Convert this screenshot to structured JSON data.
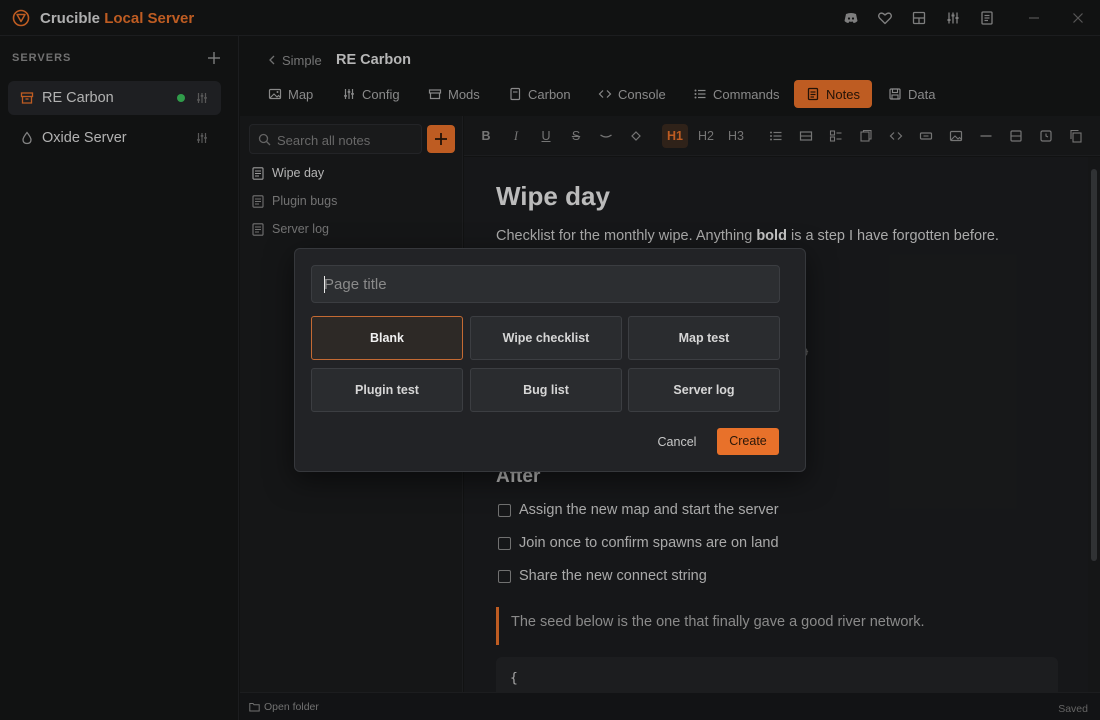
{
  "app": {
    "title_primary": "Crucible",
    "title_accent": "Local Server",
    "accent_color": "#e8712a",
    "window_icons": [
      "discord-icon",
      "heart-icon",
      "layout-icon",
      "sliders-icon",
      "document-icon",
      "minimize-icon",
      "close-icon"
    ]
  },
  "servers": {
    "heading": "SERVERS",
    "items": [
      {
        "label": "RE Carbon",
        "icon": "server-box-icon",
        "status": "running",
        "status_color": "#3bbf5b"
      },
      {
        "label": "Oxide Server",
        "icon": "droplet-icon"
      }
    ]
  },
  "header": {
    "breadcrumb_parent": "Simple",
    "breadcrumb_current": "RE Carbon",
    "tabs": [
      {
        "label": "Map",
        "icon": "image-icon"
      },
      {
        "label": "Config",
        "icon": "sliders-icon"
      },
      {
        "label": "Mods",
        "icon": "box-icon"
      },
      {
        "label": "Carbon",
        "icon": "file-icon"
      },
      {
        "label": "Console",
        "icon": "code-icon"
      },
      {
        "label": "Commands",
        "icon": "list-icon"
      },
      {
        "label": "Notes",
        "icon": "note-icon",
        "active": true
      },
      {
        "label": "Data",
        "icon": "database-icon"
      }
    ]
  },
  "notes": {
    "search_placeholder": "Search all notes",
    "items": [
      {
        "label": "Wipe day",
        "active": true
      },
      {
        "label": "Plugin bugs"
      },
      {
        "label": "Server log"
      }
    ]
  },
  "toolbar": {
    "bold": "B",
    "italic": "I",
    "underline": "U",
    "strike": "S",
    "h1": "H1",
    "h2": "H2",
    "h3": "H3"
  },
  "editor": {
    "title": "Wipe day",
    "intro_before": "Checklist for the monthly wipe. Anything ",
    "intro_bold": "bold",
    "intro_after": " is a step I have forgotten before.",
    "hidden_fragment": "ap",
    "section_after": "After",
    "checklist": [
      "Assign the new map and start the server",
      "Join once to confirm spawns are on land",
      "Share the new connect string"
    ],
    "quote": "The seed below is the one that finally gave a good river network.",
    "code_first_line": "{"
  },
  "statusbar": {
    "open_folder": "Open folder",
    "saved": "Saved"
  },
  "modal": {
    "placeholder": "Page title",
    "templates": [
      "Blank",
      "Wipe checklist",
      "Map test",
      "Plugin test",
      "Bug list",
      "Server log"
    ],
    "selected_template": "Blank",
    "cancel": "Cancel",
    "create": "Create"
  }
}
